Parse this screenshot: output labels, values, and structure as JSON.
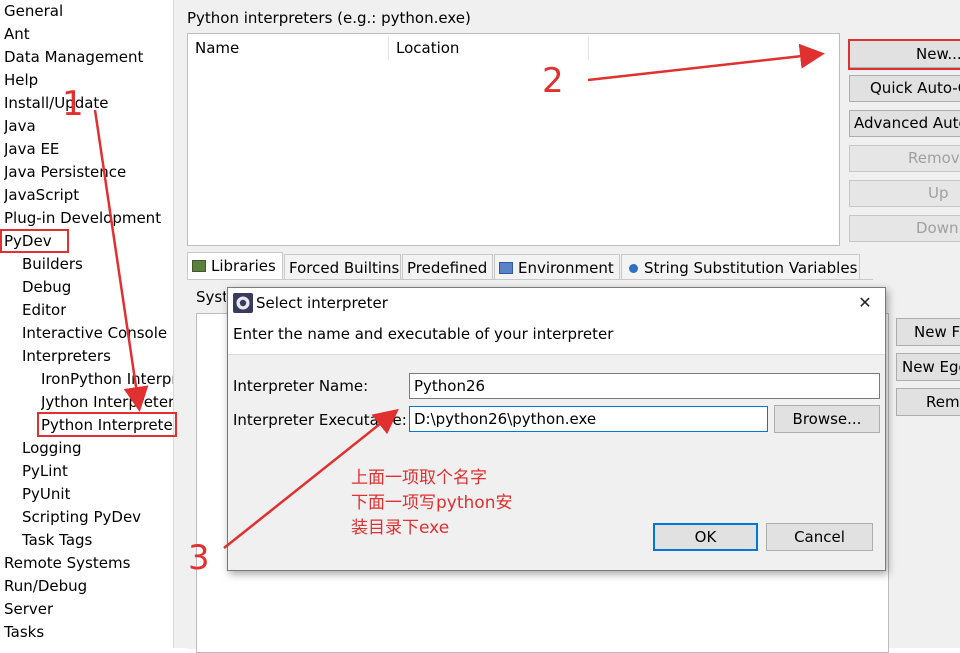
{
  "tree": {
    "items": [
      {
        "label": "General",
        "level": 0
      },
      {
        "label": "Ant",
        "level": 0
      },
      {
        "label": "Data Management",
        "level": 0
      },
      {
        "label": "Help",
        "level": 0
      },
      {
        "label": "Install/Update",
        "level": 0
      },
      {
        "label": "Java",
        "level": 0
      },
      {
        "label": "Java EE",
        "level": 0
      },
      {
        "label": "Java Persistence",
        "level": 0
      },
      {
        "label": "JavaScript",
        "level": 0
      },
      {
        "label": "Plug-in Development",
        "level": 0
      },
      {
        "label": "PyDev",
        "level": 0
      },
      {
        "label": "Builders",
        "level": 1
      },
      {
        "label": "Debug",
        "level": 1
      },
      {
        "label": "Editor",
        "level": 1
      },
      {
        "label": "Interactive Console",
        "level": 1
      },
      {
        "label": "Interpreters",
        "level": 1
      },
      {
        "label": "IronPython Interpreter",
        "level": 2
      },
      {
        "label": "Jython Interpreter",
        "level": 2
      },
      {
        "label": "Python Interpreter",
        "level": 2
      },
      {
        "label": "Logging",
        "level": 1
      },
      {
        "label": "PyLint",
        "level": 1
      },
      {
        "label": "PyUnit",
        "level": 1
      },
      {
        "label": "Scripting PyDev",
        "level": 1
      },
      {
        "label": "Task Tags",
        "level": 1
      },
      {
        "label": "Remote Systems",
        "level": 0
      },
      {
        "label": "Run/Debug",
        "level": 0
      },
      {
        "label": "Server",
        "level": 0
      },
      {
        "label": "Tasks",
        "level": 0
      }
    ]
  },
  "interpreters": {
    "section_label": "Python interpreters (e.g.: python.exe)",
    "columns": [
      "Name",
      "Location"
    ],
    "buttons": {
      "new": "New...",
      "quick_auto": "Quick Auto-Config",
      "advanced_auto": "Advanced Auto-Config",
      "remove": "Remove",
      "up": "Up",
      "down": "Down"
    }
  },
  "tabs": [
    {
      "label": "Libraries",
      "icon": "libraries-icon"
    },
    {
      "label": "Forced Builtins",
      "icon": ""
    },
    {
      "label": "Predefined",
      "icon": ""
    },
    {
      "label": "Environment",
      "icon": "environment-icon"
    },
    {
      "label": "String Substitution Variables",
      "icon": "variables-icon"
    }
  ],
  "libraries": {
    "system_label": "System PYTHONPATH",
    "buttons": {
      "new_folder": "New Folder",
      "new_egg": "New Egg/Zip(s)",
      "remove": "Remove"
    }
  },
  "dialog": {
    "title": "Select interpreter",
    "instruction": "Enter the name and executable of your interpreter",
    "name_label": "Interpreter Name:",
    "name_value": "Python26",
    "exe_label": "Interpreter Executable:",
    "exe_value": "D:\\python26\\python.exe",
    "browse": "Browse...",
    "ok": "OK",
    "cancel": "Cancel",
    "close_glyph": "✕"
  },
  "annotations": {
    "color": "#e03030",
    "step1": "1",
    "step2": "2",
    "step3": "3",
    "note_lines": [
      "上面一项取个名字",
      "下面一项写python安",
      "装目录下exe"
    ]
  }
}
